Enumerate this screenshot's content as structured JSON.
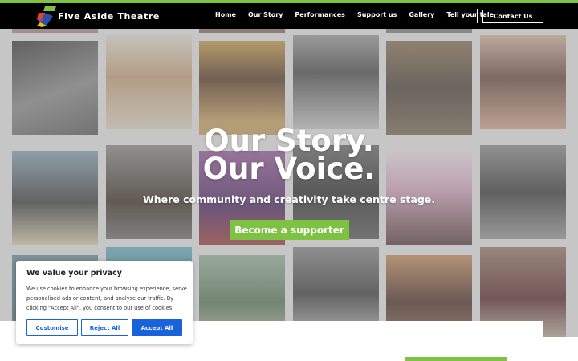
{
  "brand": {
    "name": "Five Aside Theatre",
    "accent_color": "#7dc242",
    "logo_icon": "five-aside-logo-icon"
  },
  "nav": {
    "links": [
      "Home",
      "Our Story",
      "Performances",
      "Support us",
      "Gallery",
      "Tell your tale"
    ],
    "contact_label": "Contact Us"
  },
  "hero": {
    "title_line1": "Our Story.",
    "title_line2": "Our Voice.",
    "subtitle": "Where community and creativity take centre stage.",
    "cta_label": "Become a supporter",
    "background": "photo-collage"
  },
  "cookie_banner": {
    "title": "We value your privacy",
    "text": "We use cookies to enhance your browsing experience, serve personalised ads or content, and analyse our traffic. By clicking \"Accept All\", you consent to our use of cookies.",
    "customise_label": "Customise",
    "reject_label": "Reject All",
    "accept_label": "Accept All",
    "button_color": "#1863dc"
  }
}
